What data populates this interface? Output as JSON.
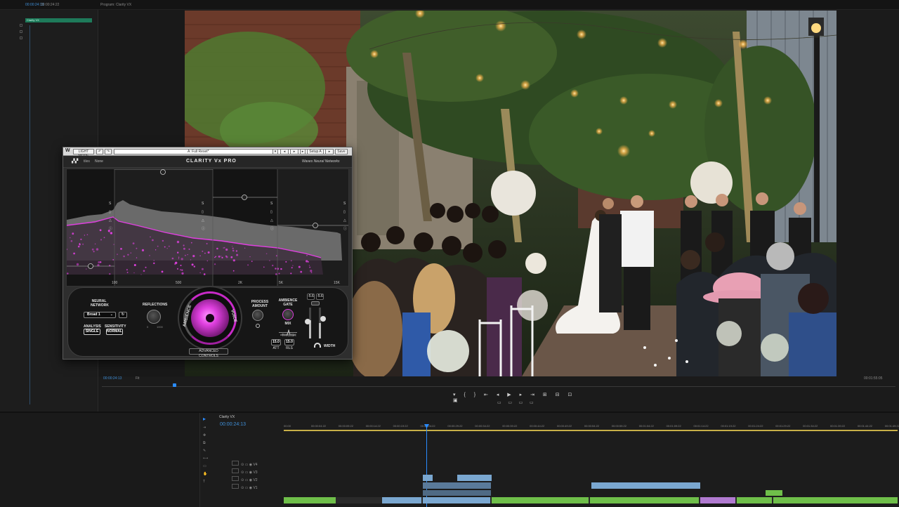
{
  "app": {
    "sequence_title": "Clarity VX",
    "top_title": "Program: Clarity VX",
    "top_timecodes": [
      "00:00:24:13",
      "00:00:24:22"
    ]
  },
  "left_panel": {
    "clip_tag": "Clarity VX",
    "timecode": "00:00:24:13"
  },
  "plugin": {
    "toolbar": {
      "compare": "LIGHT MODE",
      "undo": "↶",
      "redo": "↷",
      "preset": "A: Full Reset*",
      "save": "Save",
      "setup": "Setup A"
    },
    "header": {
      "logo_text": "tiles",
      "preset_state": "None",
      "title": "CLARITY Vx PRO",
      "brand": "Waves Neural Networks"
    },
    "freq_labels": [
      "100",
      "500",
      "2K",
      "5K",
      "15K"
    ],
    "neural_network": {
      "label": "NEURAL NETWORK",
      "value": "Broad 1",
      "analysis_label": "ANALYSIS",
      "analysis_value": "SINGLE",
      "sensitivity_label": "SENSITIVITY",
      "sensitivity_value": "NORMAL"
    },
    "reflections": {
      "label": "REFLECTIONS",
      "min": "0",
      "max": "1000"
    },
    "dial": {
      "left_label": "AMBIENCE",
      "right_label": "VOICE"
    },
    "process": {
      "label": "PROCESS AMOUNT"
    },
    "gate": {
      "label": "AMBIENCE GATE",
      "mix_label": "MIX",
      "thresh_label": "THRESH",
      "att_value": "15.0",
      "att_label": "ATT",
      "rls_value": "15.0",
      "rls_label": "RLS"
    },
    "meter": {
      "left": "-5.6",
      "right": "-5.6",
      "width_label": "WIDTH"
    },
    "advanced_controls": "ADVANCED CONTROLS"
  },
  "program_monitor": {
    "timecode": "00:00:24:13",
    "zoom": "Fit",
    "duration": "00:01:55:05"
  },
  "timeline": {
    "tab": "Clarity VX",
    "timecode": "00:00:24:13",
    "ruler": [
      "00:00",
      "00:00:04:22",
      "00:00:09:22",
      "00:00:14:22",
      "00:00:19:22",
      "00:00:24:22",
      "00:00:29:22",
      "00:00:34:22",
      "00:00:39:22",
      "00:00:44:22",
      "00:00:49:22",
      "00:00:54:22",
      "00:00:59:22",
      "00:01:04:22",
      "00:01:09:22",
      "00:01:14:22",
      "00:01:19:22",
      "00:01:24:22",
      "00:01:29:22",
      "00:01:34:22",
      "00:01:39:22",
      "00:01:44:22",
      "00:01:49:22"
    ],
    "tracks": [
      "V4",
      "V3",
      "V2",
      "V1"
    ],
    "colors": {
      "playhead": "#2a8cff",
      "clip_video": "#7aa7d0",
      "clip_green": "#6fbf4a",
      "clip_purple": "#b07ad0",
      "work_area": "#c8b048"
    }
  }
}
